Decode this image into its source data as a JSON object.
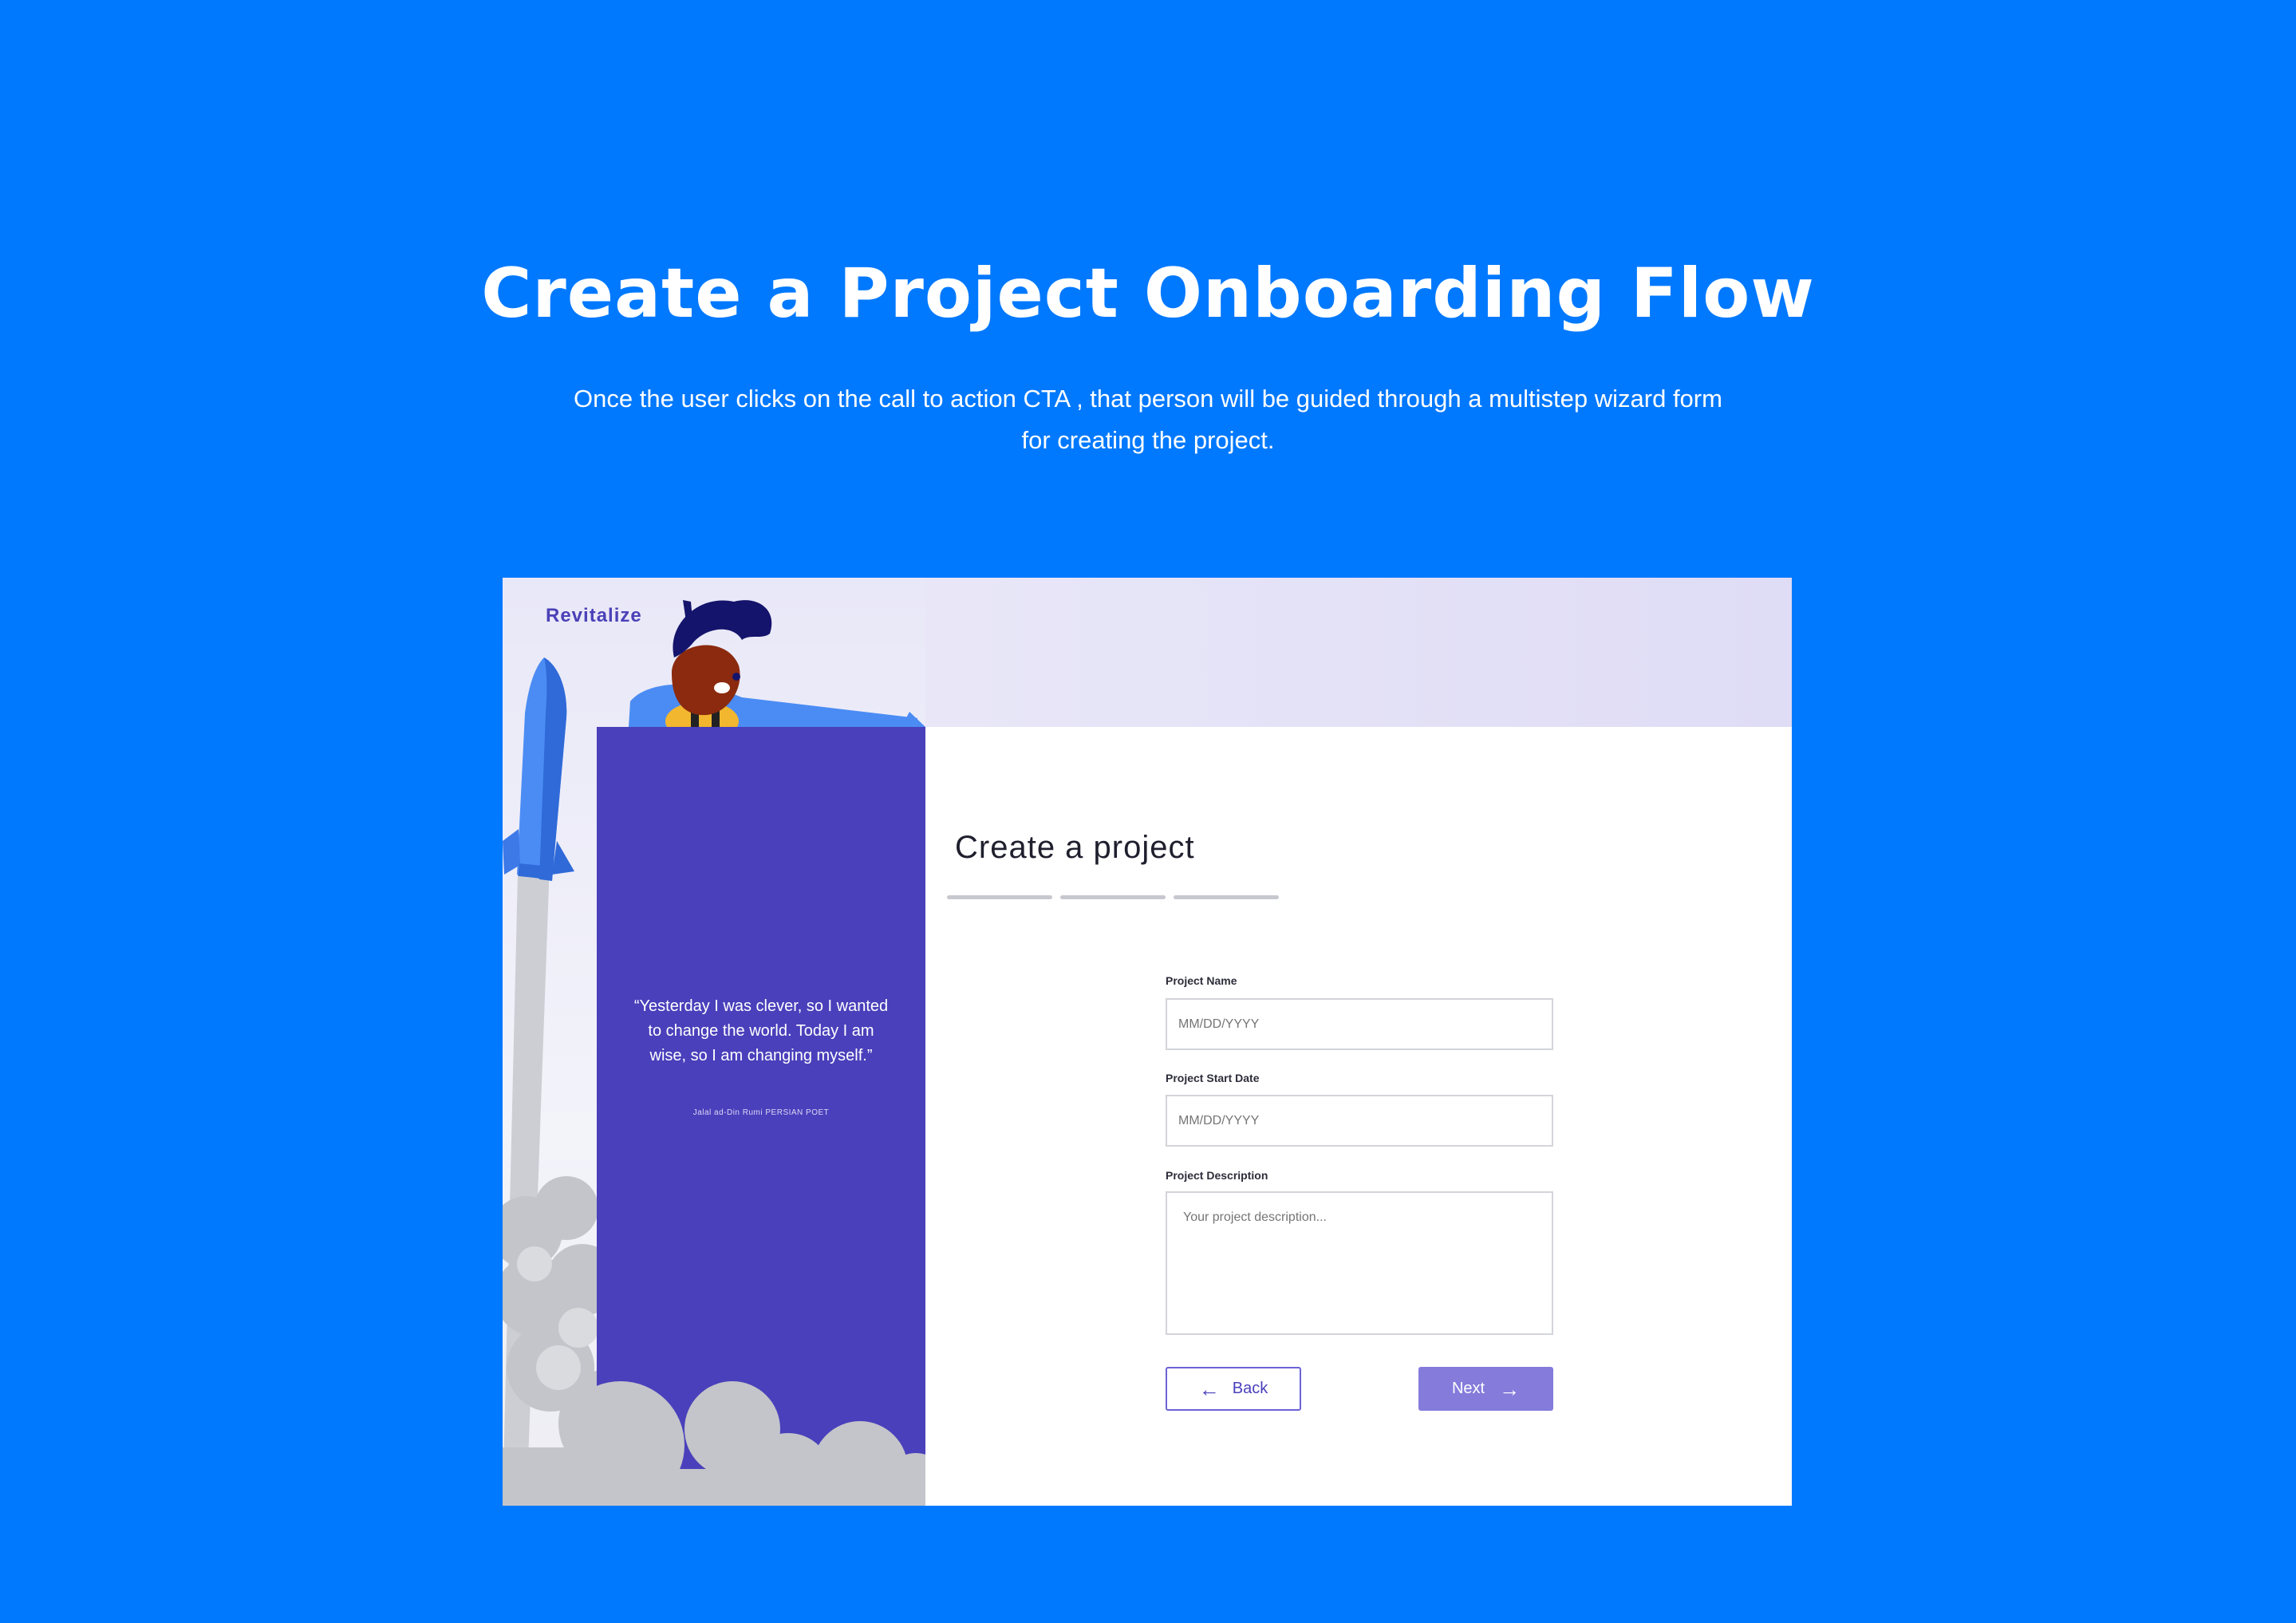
{
  "hero": {
    "title": "Create a Project Onboarding Flow",
    "subtitle": "Once the user clicks on  the call to action CTA , that person will be guided through a multistep wizard form for creating the project."
  },
  "app": {
    "brand": "Revitalize",
    "quote": "“Yesterday I was clever, so I wanted to change the world. Today I am wise, so I am changing myself.”",
    "quote_author": "Jalal ad-Din Rumi PERSIAN POET"
  },
  "form": {
    "title": "Create a project",
    "steps_total": 3,
    "project_name_label": "Project Name",
    "project_name_placeholder": "MM/DD/YYYY",
    "start_date_label": "Project Start Date",
    "start_date_placeholder": "MM/DD/YYYY",
    "description_label": "Project Description",
    "description_placeholder": "Your project description...",
    "back_label": "Back",
    "next_label": "Next",
    "back_icon": "arrow-left-icon",
    "next_icon": "arrow-right-icon"
  },
  "colors": {
    "page_bg": "#0179FE",
    "panel_purple": "#4A40BB",
    "next_button": "#857BDB",
    "step_bar": "#C7C8CF"
  }
}
